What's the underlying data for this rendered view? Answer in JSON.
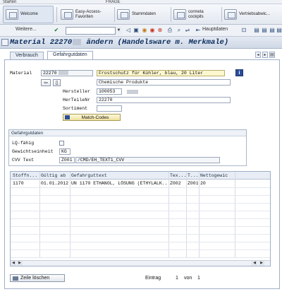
{
  "topstrip": {
    "text": "Starten",
    "right": "FRAGE"
  },
  "favorites": [
    {
      "label": "Welcome"
    },
    {
      "label": "Easy-Access-\nFavoriten"
    },
    {
      "label": "Stammdaten"
    },
    {
      "label": "cormeta\ncockpits"
    },
    {
      "label": "Vertriebsabwic..."
    }
  ],
  "toolbar": {
    "weitere": "Weitere...",
    "hauptdaten": "Hauptdaten"
  },
  "title": {
    "prefix": "Material 22270",
    "suffix": "ändern (Handelsware m. Merkmale)"
  },
  "tabs": [
    {
      "label": "Verbrauch"
    },
    {
      "label": "Gefahrgutdaten"
    }
  ],
  "material": {
    "label": "Material",
    "value": "22270",
    "description": "Frostschutz für Kühler, blau, 20 Liter",
    "category": "Chemische Produkte"
  },
  "hersteller": {
    "label": "Hersteller",
    "value": "100053"
  },
  "herteilenr": {
    "label": "HerTeileNr",
    "value": "22270"
  },
  "sortiment": {
    "label": "Sortiment",
    "value": ""
  },
  "matchcodes": {
    "label": "Match-Codes"
  },
  "group": {
    "title": "Gefahrgutdaten",
    "lq_label": "LQ-fähig",
    "gewicht_label": "Gewichtseinheit",
    "gewicht_value": "KG",
    "cvv_label": "CVV Text",
    "cvv_code": "Z001",
    "cvv_value": "/CMD/EH_TEXT1_CVV"
  },
  "table": {
    "headers": [
      "Stoffn...",
      "Gültig ab",
      "Gefahrguttext",
      "Tex...",
      "T...",
      "Nettogewic"
    ],
    "rows": [
      [
        "1170",
        "01.01.2012",
        "UN 1170 ETHANOL, LÖSUNG (ETHYLALK...",
        "Z002",
        "Z001",
        "20"
      ]
    ]
  },
  "footer": {
    "delete_label": "Zeile löschen",
    "entry_label": "Eintrag",
    "entry_current": "1",
    "of_label": "von",
    "entry_total": "1"
  }
}
